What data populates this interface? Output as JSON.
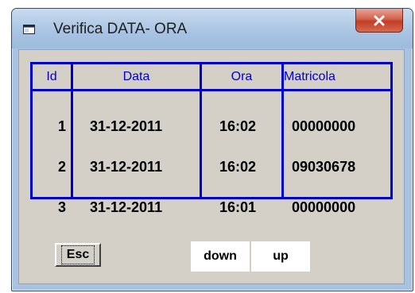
{
  "window": {
    "title": "Verifica DATA- ORA",
    "close_label": "x"
  },
  "grid": {
    "columns": [
      "Id",
      "Data",
      "Ora",
      "Matricola"
    ],
    "rows": [
      {
        "id": "1",
        "data": "31-12-2011",
        "ora": "16:02",
        "matricola": "00000000"
      },
      {
        "id": "2",
        "data": "31-12-2011",
        "ora": "16:02",
        "matricola": "09030678"
      },
      {
        "id": "3",
        "data": "31-12-2011",
        "ora": "16:01",
        "matricola": "00000000"
      }
    ],
    "border_color": "#0000cc"
  },
  "buttons": {
    "esc": "Esc",
    "down": "down",
    "up": "up"
  },
  "icons": {
    "app": "window-app-icon",
    "close": "close-icon"
  }
}
